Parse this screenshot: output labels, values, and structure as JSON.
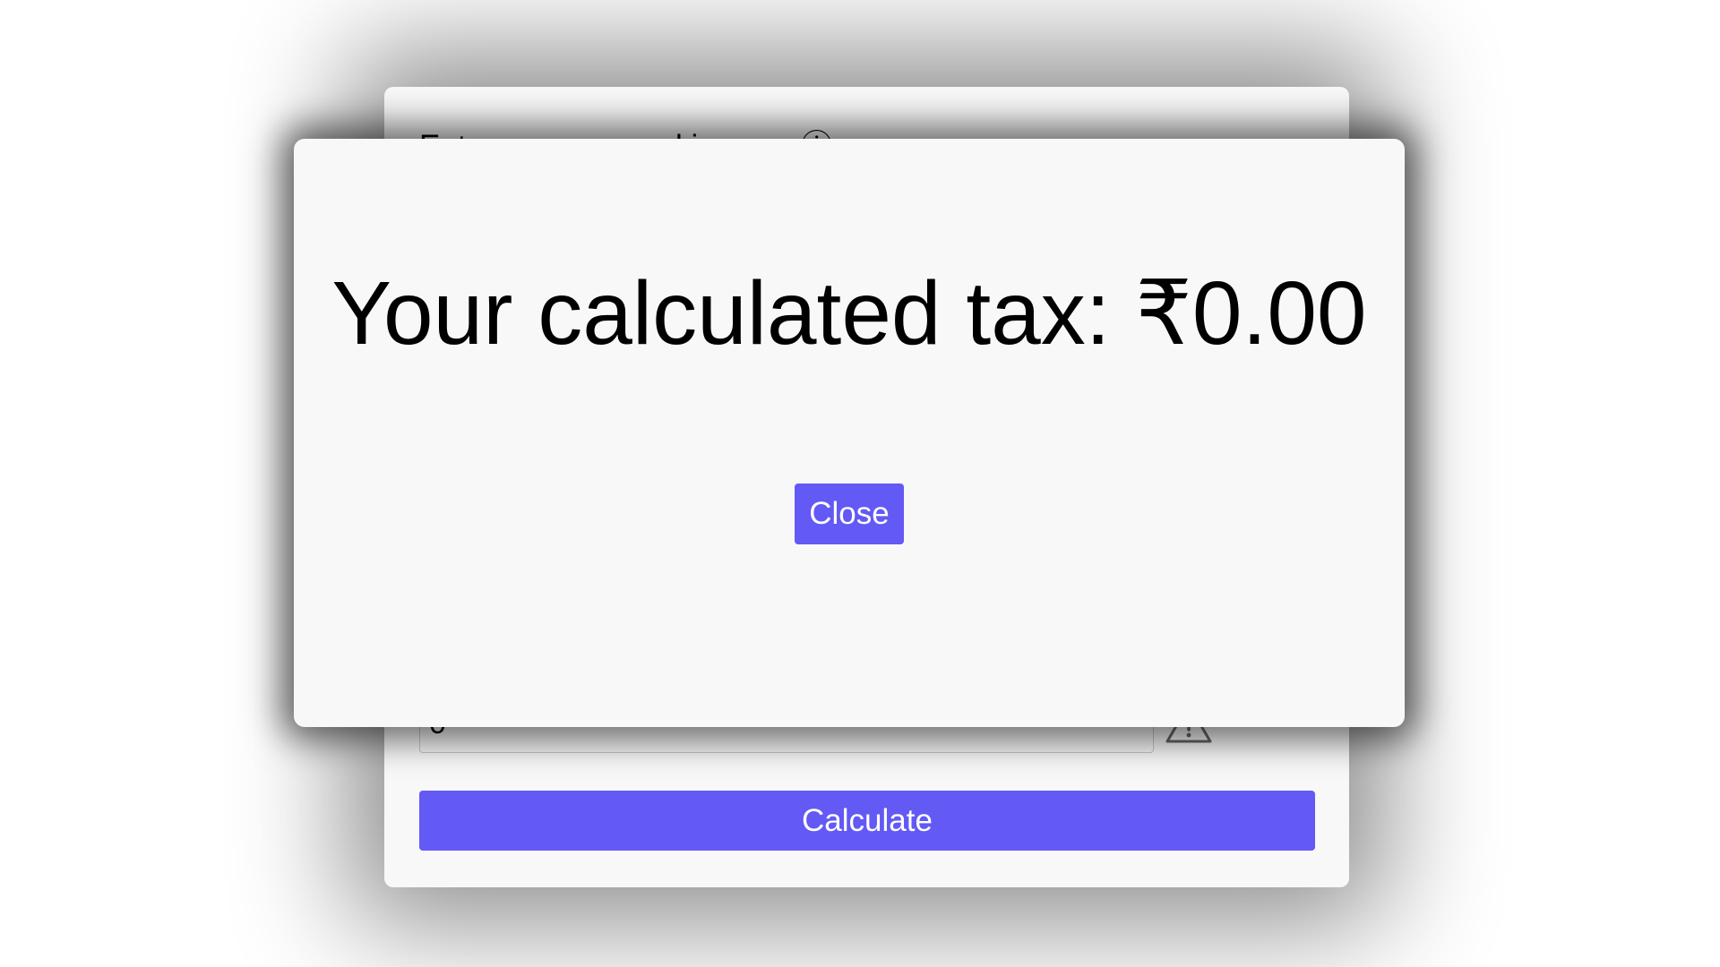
{
  "calculator": {
    "income_label": "Enter gross annual income ⓘ",
    "income_value": "0",
    "calculate_label": "Calculate"
  },
  "modal": {
    "result_text": "Your calculated tax: ₹0.00",
    "close_label": "Close"
  },
  "icons": {
    "warning": "warning-triangle-icon",
    "info": "info-icon"
  },
  "colors": {
    "accent": "#6359f5",
    "card_bg": "#f8f8f8"
  }
}
